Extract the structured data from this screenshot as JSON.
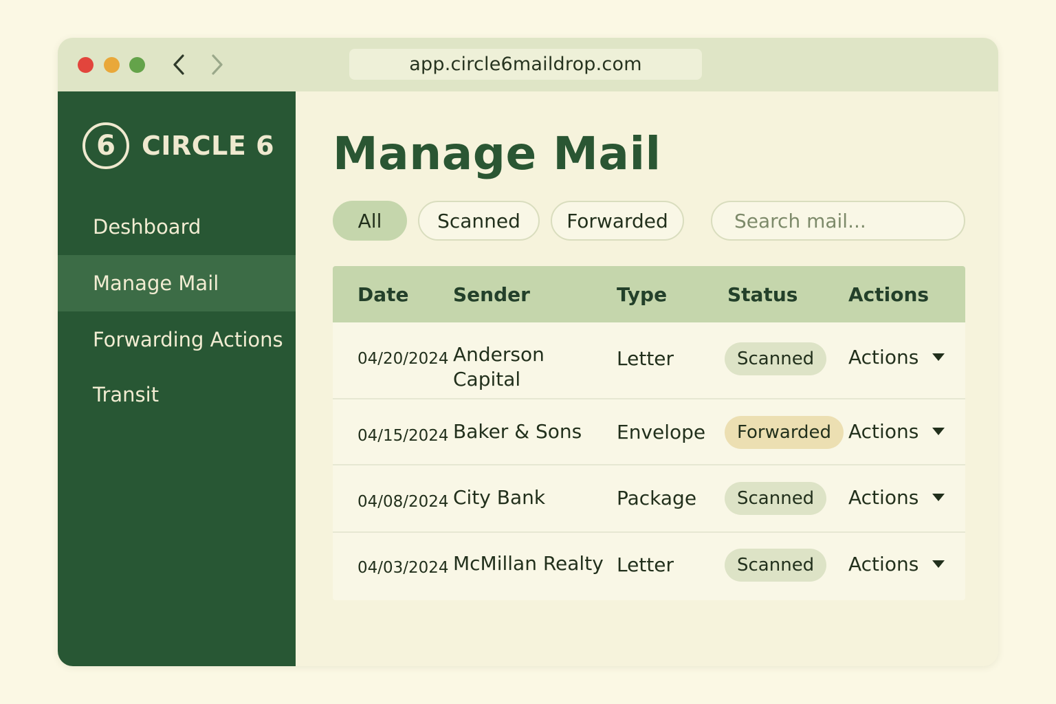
{
  "browser": {
    "url": "app.circle6maildrop.com"
  },
  "brand": {
    "logo_number": "6",
    "name": "CIRCLE 6"
  },
  "sidebar": {
    "items": [
      {
        "label": "Deshboard"
      },
      {
        "label": "Manage Mail",
        "active": true
      },
      {
        "label": "Forwarding Actions"
      },
      {
        "label": "Transit"
      }
    ]
  },
  "main": {
    "title": "Manage Mail",
    "filters": [
      {
        "label": "All",
        "active": true
      },
      {
        "label": "Scanned"
      },
      {
        "label": "Forwarded"
      }
    ],
    "search": {
      "placeholder": "Search mail...",
      "value": ""
    },
    "table": {
      "columns": [
        "Date",
        "Sender",
        "Type",
        "Status",
        "Actions"
      ],
      "rows": [
        {
          "date": "04/20/2024",
          "sender_line1": "Anderson",
          "sender_line2": "Capital",
          "type": "Letter",
          "status": "Scanned",
          "action": "Actions"
        },
        {
          "date": "04/15/2024",
          "sender_line1": "Baker & Sons",
          "sender_line2": "",
          "type": "Envelope",
          "status": "Forwarded",
          "action": "Actions"
        },
        {
          "date": "04/08/2024",
          "sender_line1": "City Bank",
          "sender_line2": "",
          "type": "Package",
          "status": "Scanned",
          "action": "Actions"
        },
        {
          "date": "04/03/2024",
          "sender_line1": "McMillan Realty",
          "sender_line2": "",
          "type": "Letter",
          "status": "Scanned",
          "action": "Actions"
        }
      ]
    }
  },
  "icons": {
    "back": "chevron-left-icon",
    "forward": "chevron-right-icon",
    "actions": "caret-down-icon"
  },
  "colors": {
    "sidebar": "#285734",
    "sidebar_active": "#3c6c46",
    "accent": "#c5d6ac",
    "status_scanned": "#dde3c6",
    "status_forwarded": "#ecdfb2",
    "title": "#2a5633"
  }
}
